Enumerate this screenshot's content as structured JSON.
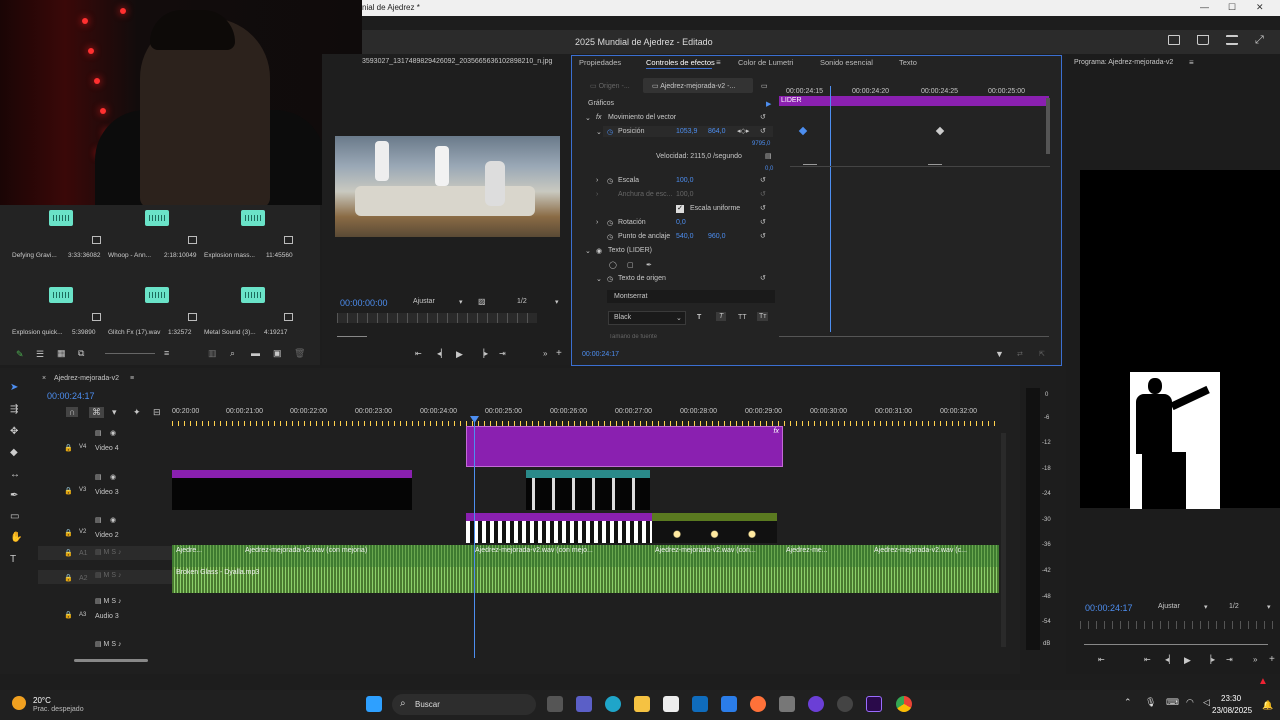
{
  "window": {
    "title_fragment": "nial de Ajedrez *",
    "app_title": "2025 Mundial de Ajedrez - Editado"
  },
  "media_files": {
    "filename": "3593027_1317489829426092_2035665636102898210_n.jpg"
  },
  "audio_items": [
    {
      "name": "Defying Gravi...",
      "dur": "3:33:36082"
    },
    {
      "name": "Whoop - Ann...",
      "dur": "2:18:10049"
    },
    {
      "name": "Explosion mass...",
      "dur": "11:45560"
    },
    {
      "name": "Explosion quick...",
      "dur": "5:39890"
    },
    {
      "name": "Glitch Fx (17).wav",
      "dur": "1:32572"
    },
    {
      "name": "Metal Sound (3)...",
      "dur": "4:19217"
    }
  ],
  "source": {
    "timecode": "00:00:00:00",
    "zoom": "Ajustar",
    "res": "1/2"
  },
  "effects": {
    "tabs": [
      "Propiedades",
      "Controles de efectos",
      "Color de Lumetri",
      "Sonido esencial",
      "Texto"
    ],
    "origin": "Origen -...",
    "seq": "Ajedrez-mejorada-v2 -...",
    "section": "Gráficos",
    "motion": "Movimiento del vector",
    "position_label": "Posición",
    "pos_x": "1053,9",
    "pos_y": "864,0",
    "val_top": "9795,0",
    "val_zero": "0,0",
    "velocity": "Velocidad: 2115,0 /segundo",
    "scale_label": "Escala",
    "scale": "100,0",
    "width_label": "Anchura de esc...",
    "width": "100,0",
    "uniform": "Escala uniforme",
    "rotation_label": "Rotación",
    "rotation": "0,0",
    "anchor_label": "Punto de anclaje",
    "anchor_x": "540,0",
    "anchor_y": "960,0",
    "text_layer": "Texto (LIDER)",
    "source_text": "Texto de origen",
    "font": "Montserrat",
    "style": "Black",
    "font_size_partial": "Tamaño de fuente",
    "tc_marks": [
      "00:00:24:15",
      "00:00:24:20",
      "00:00:24:25",
      "00:00:25:00"
    ],
    "clip_name": "LIDER",
    "current_tc": "00:00:24:17"
  },
  "timeline": {
    "seq_name": "Ajedrez-mejorada-v2",
    "tc": "00:00:24:17",
    "ruler": [
      "00:20:00",
      "00:00:21:00",
      "00:00:22:00",
      "00:00:23:00",
      "00:00:24:00",
      "00:00:25:00",
      "00:00:26:00",
      "00:00:27:00",
      "00:00:28:00",
      "00:00:29:00",
      "00:00:30:00",
      "00:00:31:00",
      "00:00:32:00"
    ],
    "tracks": {
      "v4": "Video 4",
      "v3": "Video 3",
      "v2": "Video 2",
      "a3": "Audio 3",
      "a1": "A1",
      "a2": "A2"
    },
    "audio_clips": [
      "Ajedre...",
      "Ajedrez-mejorada-v2.wav (con mejoria)",
      "Ajedrez-mejorada-v2.wav (con mejo...",
      "Ajedrez-mejorada-v2.wav (con...",
      "Ajedrez-me...",
      "Ajedrez-mejorada-v2.wav (c..."
    ],
    "broken": "Broken Glass - Dyalla.mp3",
    "db": [
      "0",
      "-6",
      "-12",
      "-18",
      "-24",
      "-30",
      "-36",
      "-42",
      "-48",
      "-54",
      "dB"
    ]
  },
  "program": {
    "title": "Programa: Ajedrez-mejorada-v2",
    "tc": "00:00:24:17",
    "zoom": "Ajustar",
    "res": "1/2"
  },
  "taskbar": {
    "temp": "20°C",
    "weather": "Prac. despejado",
    "search": "Buscar",
    "time": "23:30",
    "date": "23/08/2025"
  },
  "colors": {
    "accent": "#3b6fd1",
    "purple": "#8a20b0",
    "green": "#3e7a30",
    "teal": "#2a8a8a"
  }
}
